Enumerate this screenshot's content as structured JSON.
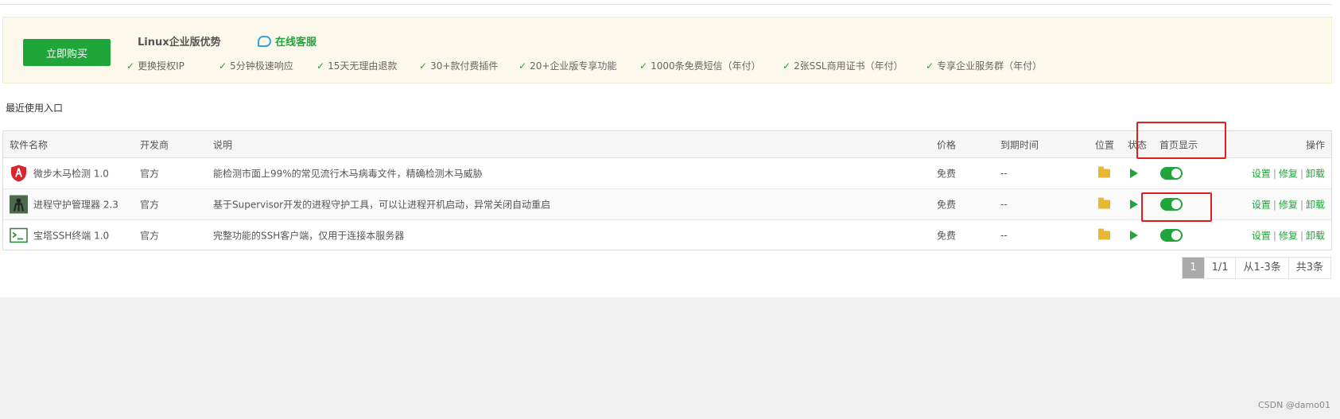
{
  "promo": {
    "buy_label": "立即购买",
    "title": "Linux企业版优势",
    "service_label": "在线客服",
    "features": [
      "更换授权IP",
      "5分钟极速响应",
      "15天无理由退款",
      "30+款付费插件",
      "20+企业版专享功能",
      "1000条免费短信（年付）",
      "2张SSL商用证书（年付）",
      "专享企业服务群（年付）"
    ]
  },
  "recent_label": "最近使用入口",
  "table": {
    "headers": {
      "name": "软件名称",
      "developer": "开发商",
      "description": "说明",
      "price": "价格",
      "expiry": "到期时间",
      "location": "位置",
      "status": "状态",
      "homepage": "首页显示",
      "actions": "操作"
    },
    "rows": [
      {
        "name": "微步木马检测 1.0",
        "icon": "shield-icon",
        "developer": "官方",
        "description": "能检测市面上99%的常见流行木马病毒文件，精确检测木马威胁",
        "price": "免费",
        "expiry": "--",
        "homepage_on": true
      },
      {
        "name": "进程守护管理器 2.3",
        "icon": "process-icon",
        "developer": "官方",
        "description": "基于Supervisor开发的进程守护工具，可以让进程开机启动，异常关闭自动重启",
        "price": "免费",
        "expiry": "--",
        "homepage_on": true
      },
      {
        "name": "宝塔SSH终端 1.0",
        "icon": "terminal-icon",
        "developer": "官方",
        "description": "完整功能的SSH客户端，仅用于连接本服务器",
        "price": "免费",
        "expiry": "--",
        "homepage_on": true
      }
    ],
    "action_labels": {
      "settings": "设置",
      "repair": "修复",
      "uninstall": "卸载",
      "separator": "|"
    }
  },
  "pager": {
    "current": "1",
    "pages": "1/1",
    "range": "从1-3条",
    "total": "共3条"
  },
  "watermark": "CSDN @damo01",
  "colors": {
    "accent": "#20a53a",
    "highlight_box": "#e02020",
    "promo_bg": "#fdf8ec"
  }
}
